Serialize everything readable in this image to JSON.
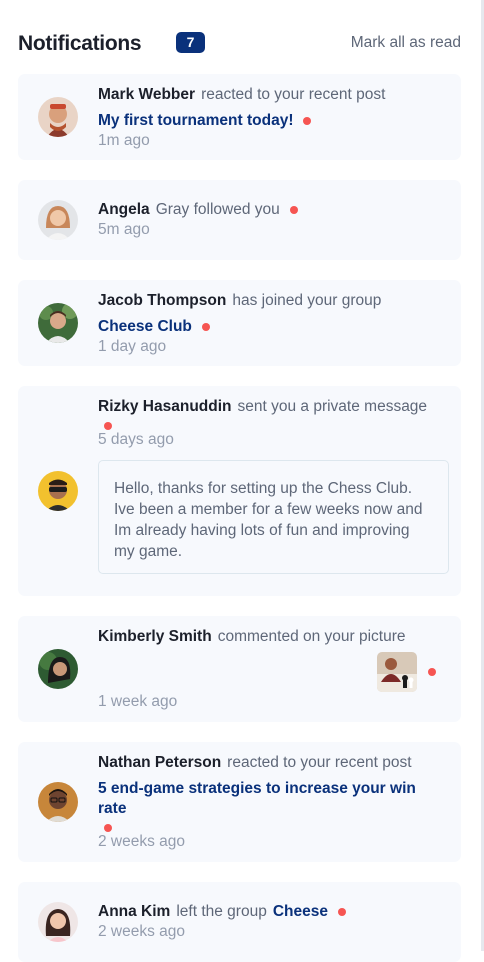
{
  "header": {
    "title": "Notifications",
    "count": "7",
    "mark_all": "Mark all as read"
  },
  "notifications": [
    {
      "name": "Mark Webber",
      "action": "reacted to your recent post",
      "target": "My first tournament today!",
      "time": "1m ago",
      "unread": true
    },
    {
      "name": "Angela",
      "action": "Gray followed you",
      "time": "5m ago",
      "unread": true
    },
    {
      "name": "Jacob Thompson",
      "action": "has joined your group",
      "target": "Cheese Club",
      "time": "1 day ago",
      "unread": true
    },
    {
      "name": "Rizky Hasanuddin",
      "action": "sent you a private message",
      "time": "5 days ago",
      "unread": true,
      "message": "Hello, thanks for setting up the Chess Club. Ive been a member for a few weeks now and Im already having lots of fun and improving my game."
    },
    {
      "name": "Kimberly Smith",
      "action": "commented on your picture",
      "time": "1 week ago",
      "unread": true
    },
    {
      "name": "Nathan Peterson",
      "action": "reacted to your recent post",
      "target": "5 end-game strategies to increase your win rate",
      "time": "2 weeks ago",
      "unread": true
    },
    {
      "name": "Anna Kim",
      "action": "left the group",
      "target": "Cheese",
      "time": "2 weeks ago",
      "unread": true
    }
  ],
  "colors": {
    "accent": "#0a317b",
    "unread_dot": "#f65552",
    "card_bg": "#f7f9fd",
    "muted_text": "#5e6778",
    "time_text": "#939cad"
  }
}
